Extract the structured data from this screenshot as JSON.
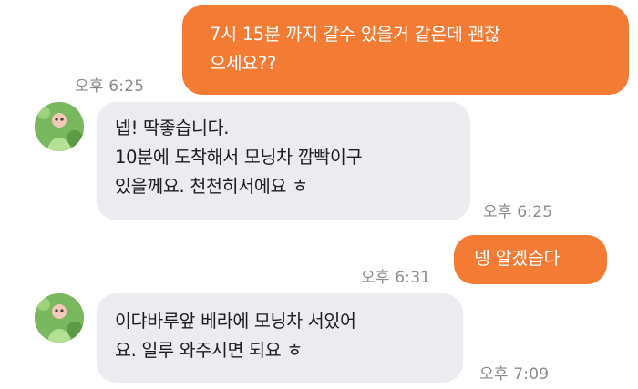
{
  "messages": [
    {
      "direction": "outgoing",
      "text": "7시 15분 까지 갈수 있을거 같은데 괜찮\n으세요??",
      "time": "오후 6:25"
    },
    {
      "direction": "incoming",
      "text": "넵! 딱좋습니다.\n10분에 도착해서 모닝차 깜빡이구\n있을께요. 천천히서에요 ㅎ",
      "time": "오후 6:25"
    },
    {
      "direction": "outgoing",
      "text": "넹 알겠습다",
      "time": "오후 6:31"
    },
    {
      "direction": "incoming",
      "text": "이댜바루앞 베라에 모닝차 서있어\n요. 일루 와주시면 되요 ㅎ",
      "time": "오후 7:09"
    }
  ],
  "colors": {
    "outgoing_bubble": "#f47b33",
    "incoming_bubble": "#ececf0",
    "timestamp": "#8a8a8f",
    "avatar": "#79b85e"
  },
  "icons": {
    "avatar": "profile-avatar-icon"
  }
}
